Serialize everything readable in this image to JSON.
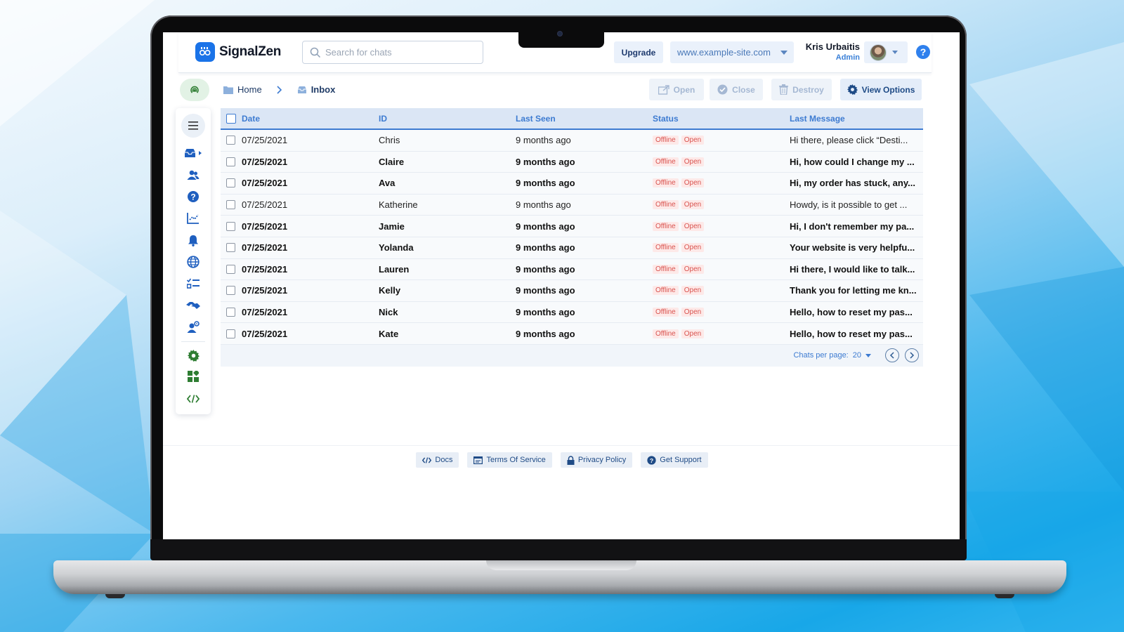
{
  "app": {
    "logo_text": "SignalZen"
  },
  "header": {
    "search_placeholder": "Search for chats",
    "upgrade_label": "Upgrade",
    "site_selected": "www.example-site.com",
    "user_name": "Kris Urbaitis",
    "user_role": "Admin"
  },
  "breadcrumb": {
    "home": "Home",
    "current": "Inbox"
  },
  "toolbar": {
    "open": "Open",
    "close": "Close",
    "destroy": "Destroy",
    "view_options": "View Options"
  },
  "sidebar": {
    "items": [
      "menu-icon",
      "inbox-icon",
      "users-icon",
      "help-icon",
      "analytics-icon",
      "bell-icon",
      "globe-icon",
      "tasks-icon",
      "handshake-icon",
      "user-settings-icon",
      "gear-icon",
      "widgets-icon",
      "code-icon"
    ]
  },
  "table": {
    "columns": {
      "date": "Date",
      "id": "ID",
      "last_seen": "Last Seen",
      "status": "Status",
      "last_message": "Last Message"
    },
    "rows": [
      {
        "date": "07/25/2021",
        "id": "Chris",
        "last_seen": "9 months ago",
        "status1": "Offline",
        "status2": "Open",
        "message": "Hi there, please click “Desti...",
        "unread": false
      },
      {
        "date": "07/25/2021",
        "id": "Claire",
        "last_seen": "9 months ago",
        "status1": "Offline",
        "status2": "Open",
        "message": "Hi, how could I change my ...",
        "unread": true
      },
      {
        "date": "07/25/2021",
        "id": "Ava",
        "last_seen": "9 months ago",
        "status1": "Offline",
        "status2": "Open",
        "message": "Hi, my order has stuck, any...",
        "unread": true
      },
      {
        "date": "07/25/2021",
        "id": "Katherine",
        "last_seen": "9 months ago",
        "status1": "Offline",
        "status2": "Open",
        "message": "Howdy, is it possible to get ...",
        "unread": false
      },
      {
        "date": "07/25/2021",
        "id": "Jamie",
        "last_seen": "9 months ago",
        "status1": "Offline",
        "status2": "Open",
        "message": "Hi, I don't remember my pa...",
        "unread": true
      },
      {
        "date": "07/25/2021",
        "id": "Yolanda",
        "last_seen": "9 months ago",
        "status1": "Offline",
        "status2": "Open",
        "message": "Your website is very helpfu...",
        "unread": true
      },
      {
        "date": "07/25/2021",
        "id": "Lauren",
        "last_seen": "9 months ago",
        "status1": "Offline",
        "status2": "Open",
        "message": "Hi there, I would like to talk...",
        "unread": true
      },
      {
        "date": "07/25/2021",
        "id": "Kelly",
        "last_seen": "9 months ago",
        "status1": "Offline",
        "status2": "Open",
        "message": "Thank you for letting me kn...",
        "unread": true
      },
      {
        "date": "07/25/2021",
        "id": "Nick",
        "last_seen": "9 months ago",
        "status1": "Offline",
        "status2": "Open",
        "message": "Hello, how to reset my pas...",
        "unread": true
      },
      {
        "date": "07/25/2021",
        "id": "Kate",
        "last_seen": "9 months ago",
        "status1": "Offline",
        "status2": "Open",
        "message": "Hello, how to reset my pas...",
        "unread": true
      }
    ],
    "per_page_label": "Chats per page:",
    "per_page_value": "20"
  },
  "footer": {
    "docs": "Docs",
    "terms": "Terms Of Service",
    "privacy": "Privacy Policy",
    "support": "Get Support"
  },
  "colors": {
    "accent": "#3d7bd1",
    "brand": "#1a73e8",
    "status_red": "#d9534f",
    "green_icon": "#2e7d32"
  }
}
